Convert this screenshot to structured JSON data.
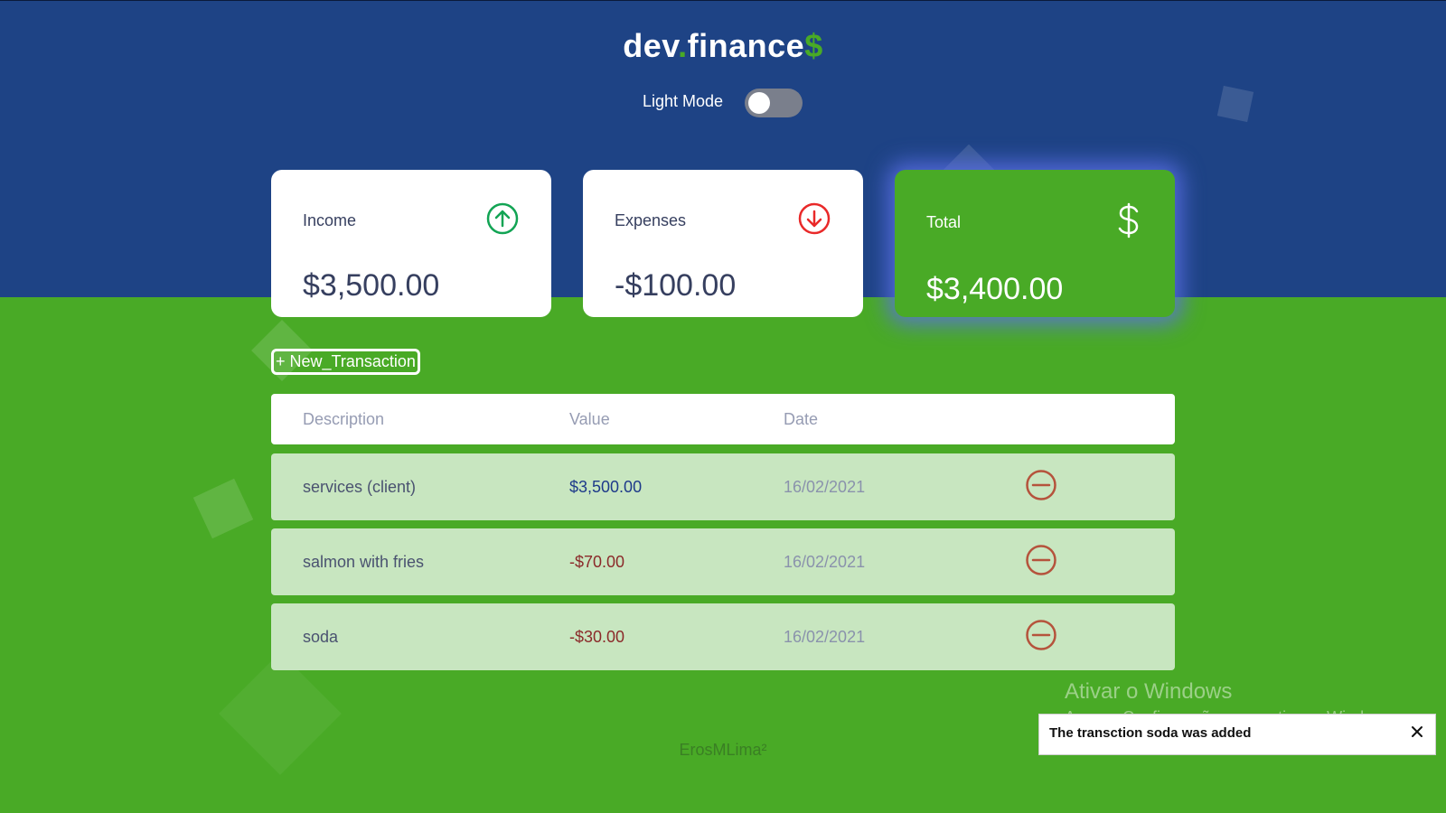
{
  "header": {
    "logo_main": "dev",
    "logo_dot": ".",
    "logo_word": "finance",
    "logo_symbol": "$",
    "mode_label": "Light Mode"
  },
  "cards": {
    "income": {
      "title": "Income",
      "value": "$3,500.00",
      "icon": "arrow-up-circle-icon"
    },
    "expenses": {
      "title": "Expenses",
      "value": "-$100.00",
      "icon": "arrow-down-circle-icon"
    },
    "total": {
      "title": "Total",
      "value": "$3,400.00",
      "icon": "dollar-icon"
    }
  },
  "new_transaction_label": "+ New_Transaction",
  "table": {
    "headers": [
      "Description",
      "Value",
      "Date"
    ],
    "rows": [
      {
        "description": "services (client)",
        "value": "$3,500.00",
        "date": "16/02/2021"
      },
      {
        "description": "salmon with fries",
        "value": "-$70.00",
        "date": "16/02/2021"
      },
      {
        "description": "soda",
        "value": "-$30.00",
        "date": "16/02/2021"
      }
    ]
  },
  "footer": "ErosMLima²",
  "windows_watermark": {
    "title": "Ativar o Windows",
    "subtitle": "Acesse Configurações para ativar o Windows."
  },
  "toast": {
    "message": "The transction soda was added"
  },
  "colors": {
    "header_bg": "#1e4385",
    "body_bg": "#49aa26",
    "income": "#12a454",
    "expense": "#e92929",
    "remove": "#b5533c"
  }
}
